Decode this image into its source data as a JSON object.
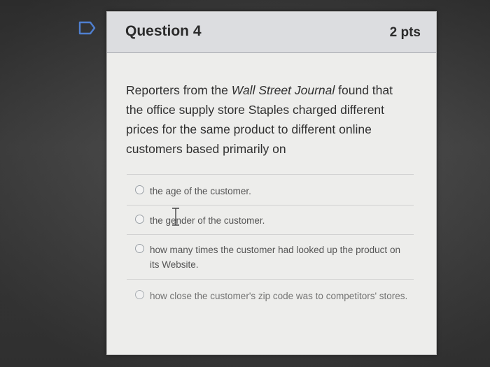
{
  "question": {
    "title": "Question 4",
    "points": "2 pts",
    "prompt_before": "Reporters from the ",
    "prompt_italic": "Wall Street Journal",
    "prompt_after": " found that the office supply store Staples charged different prices for the same product to different online customers based primarily on"
  },
  "answers": [
    {
      "label": "the age of the customer."
    },
    {
      "label": "the gender of the customer."
    },
    {
      "label": "how many times the customer had looked up the product on its Website."
    },
    {
      "label": "how close the customer's zip code was to competitors' stores."
    }
  ],
  "colors": {
    "header_bg": "#dcdde0",
    "card_bg": "#ededeb",
    "flag": "#4f7fcf"
  },
  "icons": {
    "flag": "flag-icon",
    "cursor": "text-cursor-icon"
  }
}
